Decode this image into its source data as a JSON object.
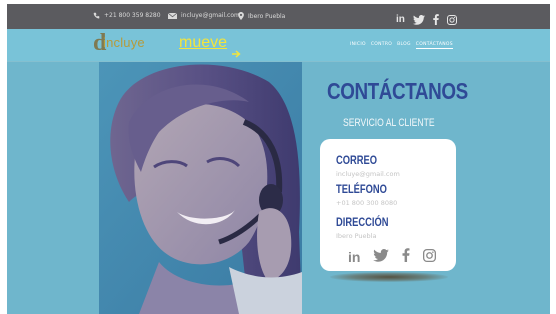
{
  "topbar": {
    "phone": "+21 800 359 8280",
    "email": "incluye@gmail.com",
    "location": "Ibero Puebla",
    "social_icons": [
      "linkedin-icon",
      "twitter-icon",
      "facebook-icon",
      "instagram-icon"
    ]
  },
  "header": {
    "logo_letter": "d",
    "logo_incluye": "incluye",
    "logo_mueve": "mueve",
    "nav": [
      "INICIO",
      "CONTRO",
      "BLOG",
      "CONTÁCTANOS"
    ],
    "active_nav": "CONTÁCTANOS"
  },
  "contact": {
    "title": "CONTÁCTANOS",
    "subtitle": "SERVICIO AL CLIENTE",
    "email_label": "CORREO",
    "email_value": "incluye@gmail.com",
    "phone_label": "TELÉFONO",
    "phone_value": "+01 800 300 8080",
    "address_label": "DIRECCIÓN",
    "address_value": "Ibero Puebla"
  },
  "colors": {
    "topbar": "#5b5b5f",
    "page_bg": "#6fb6cc",
    "heading": "#2f4a96",
    "logo_mueve": "#f3e53c"
  }
}
